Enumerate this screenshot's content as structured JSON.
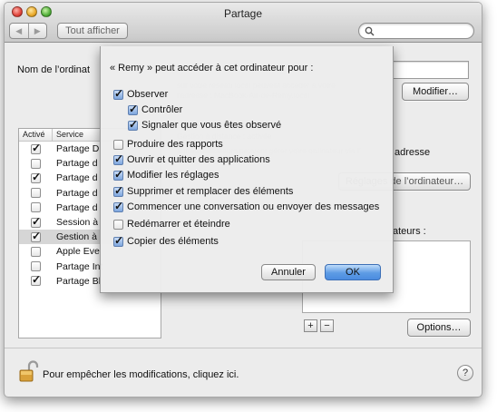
{
  "window": {
    "title": "Partage",
    "show_all": "Tout afficher",
    "nav_back": "◀",
    "nav_forward": "▶"
  },
  "main": {
    "computer_name_label": "Nom de l’ordinat",
    "modify_button": "Modifier…",
    "address_text": "adresse",
    "computer_settings_button": "Réglages de l’ordinateur…",
    "users_label": "ateurs :",
    "options_button": "Options…",
    "add_button": "+",
    "remove_button": "−"
  },
  "services": {
    "headers": {
      "active": "Activé",
      "service": "Service"
    },
    "rows": [
      {
        "name": "Partage D",
        "checked": true,
        "selected": false
      },
      {
        "name": "Partage d",
        "checked": false,
        "selected": false
      },
      {
        "name": "Partage d",
        "checked": true,
        "selected": false
      },
      {
        "name": "Partage d",
        "checked": false,
        "selected": false
      },
      {
        "name": "Partage d",
        "checked": false,
        "selected": false
      },
      {
        "name": "Session à",
        "checked": true,
        "selected": false
      },
      {
        "name": "Gestion à",
        "checked": true,
        "selected": true
      },
      {
        "name": "Apple Eve",
        "checked": false,
        "selected": false
      },
      {
        "name": "Partage Int",
        "checked": false,
        "selected": false
      },
      {
        "name": "Partage Bl",
        "checked": true,
        "selected": false
      }
    ]
  },
  "sheet": {
    "title": "« Remy » peut accéder à cet ordinateur pour :",
    "items": [
      {
        "label": "Observer",
        "checked": true
      },
      {
        "label": "Contrôler",
        "checked": true
      },
      {
        "label": "Signaler que vous êtes observé",
        "checked": true
      },
      {
        "label": "Produire des rapports",
        "checked": false
      },
      {
        "label": "Ouvrir et quitter des applications",
        "checked": true
      },
      {
        "label": "Modifier les réglages",
        "checked": true
      },
      {
        "label": "Supprimer et remplacer des éléments",
        "checked": true
      },
      {
        "label": "Commencer une conversation ou envoyer des messages",
        "checked": true
      },
      {
        "label": "Redémarrer et éteindre",
        "checked": false
      },
      {
        "label": "Copier des éléments",
        "checked": true
      }
    ],
    "cancel": "Annuler",
    "ok": "OK"
  },
  "footer": {
    "lock_text": "Pour empêcher les modifications, cliquez ici.",
    "help": "?"
  },
  "colors": {
    "ok_button": "#5d9be4",
    "selection": "#d6d6d6"
  }
}
